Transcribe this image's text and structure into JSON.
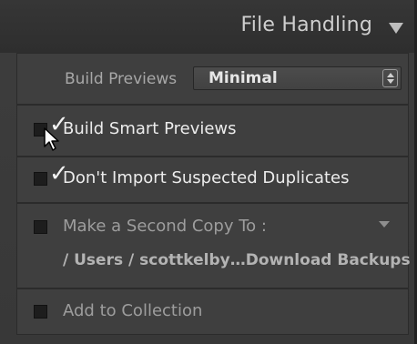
{
  "header": {
    "title": "File Handling",
    "collapse_icon": "triangle-down-icon"
  },
  "build_previews": {
    "label": "Build Previews",
    "value": "Minimal"
  },
  "options": {
    "smart_previews": {
      "label": "Build Smart Previews",
      "checked": true
    },
    "no_duplicates": {
      "label": "Don't Import Suspected Duplicates",
      "checked": true
    },
    "second_copy": {
      "label": "Make a Second Copy To :",
      "checked": false,
      "path": "/ Users / scottkelby…Download Backups"
    },
    "collection": {
      "label": "Add to Collection",
      "checked": false
    }
  },
  "colors": {
    "panel_bg": "#3d3d3d",
    "text_bright": "#ececec",
    "text_muted": "#9d9d9d"
  }
}
